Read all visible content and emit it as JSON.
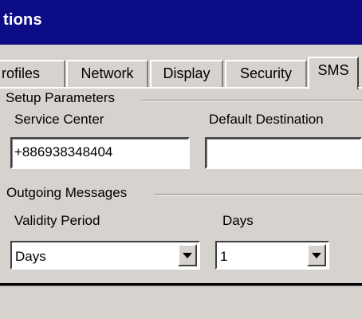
{
  "window": {
    "title": "tions"
  },
  "tabs": [
    {
      "label": "rofiles",
      "active": false
    },
    {
      "label": "Network",
      "active": false
    },
    {
      "label": "Display",
      "active": false
    },
    {
      "label": "Security",
      "active": false
    },
    {
      "label": "SMS",
      "active": true
    }
  ],
  "setup": {
    "group_label": "Setup Parameters",
    "service_center_label": "Service Center",
    "service_center_value": "+886938348404",
    "default_destination_label": "Default Destination",
    "default_destination_value": ""
  },
  "outgoing": {
    "group_label": "Outgoing Messages",
    "validity_label": "Validity Period",
    "validity_value": "Days",
    "days_label": "Days",
    "days_value": "1"
  },
  "colors": {
    "titlebar": "#0c0c86",
    "face": "#d6d3ce"
  }
}
